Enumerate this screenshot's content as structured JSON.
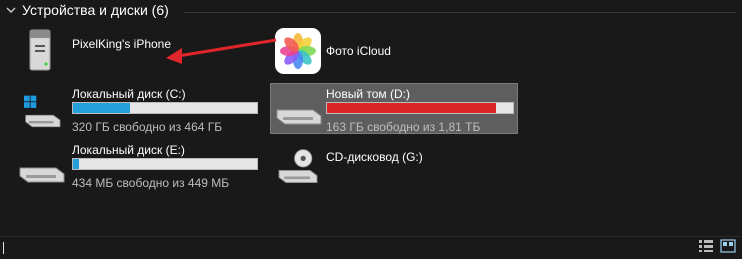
{
  "section": {
    "title": "Устройства и диски (6)"
  },
  "devices": [
    {
      "name": "PixelKing's iPhone",
      "icon": "iphone-device-icon"
    },
    {
      "name": "Фото iCloud",
      "icon": "icloud-photos-icon"
    }
  ],
  "drives": [
    {
      "name": "Локальный диск (C:)",
      "free_text": "320 ГБ свободно из 464 ГБ",
      "used_fraction": 0.31,
      "bar_color": "#26a0da",
      "icon": "windows-drive-icon"
    },
    {
      "name": "Новый том (D:)",
      "free_text": "163 ГБ свободно из 1,81 ТБ",
      "used_fraction": 0.91,
      "bar_color": "#da2626",
      "icon": "hard-drive-icon",
      "selected": true
    },
    {
      "name": "Локальный диск (E:)",
      "free_text": "434 МБ свободно из 449 МБ",
      "used_fraction": 0.03,
      "bar_color": "#26a0da",
      "icon": "hard-drive-icon"
    },
    {
      "name": "CD-дисковод (G:)",
      "icon": "cd-drive-icon"
    }
  ],
  "colors": {
    "background": "#191919",
    "accent": "#26a0da",
    "warning": "#da2626",
    "annotation": "#e0252b"
  }
}
